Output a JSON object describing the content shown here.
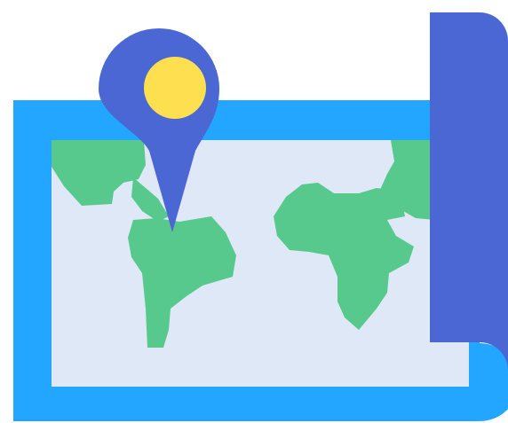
{
  "icon": {
    "name": "world-map-location-icon",
    "parts": [
      "map-frame",
      "map-paper",
      "continents",
      "map-roll",
      "location-pin"
    ]
  },
  "colors": {
    "background": "#ffffff",
    "frame": "#22a6ff",
    "paper": "#dfe8f7",
    "land": "#58c98d",
    "roll": "#4b67d4",
    "pin": "#4b67d4",
    "pin_center": "#fddf4f"
  }
}
